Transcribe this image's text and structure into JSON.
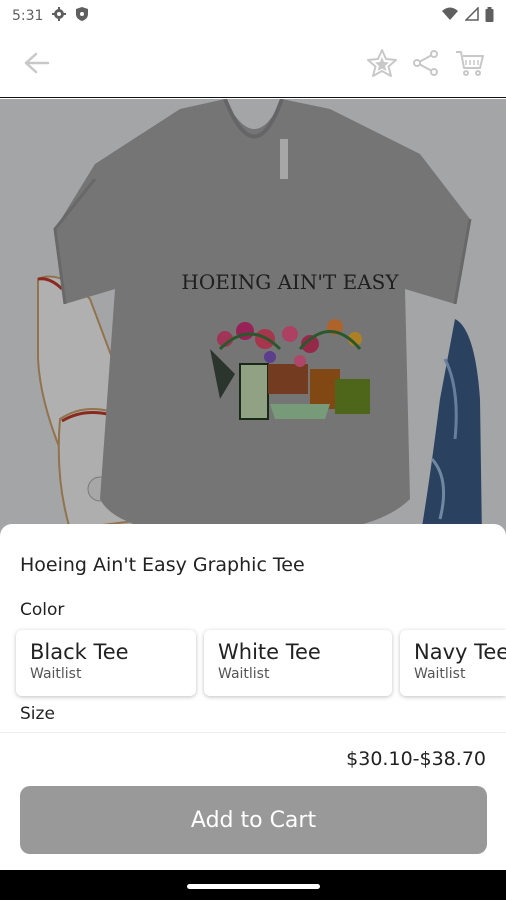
{
  "status_bar": {
    "time": "5:31"
  },
  "product": {
    "title": "Hoeing Ain't Easy Graphic Tee",
    "shirt_text": "HOEING AIN'T EASY"
  },
  "options": {
    "color_label": "Color",
    "colors": [
      {
        "name": "Black Tee",
        "status": "Waitlist"
      },
      {
        "name": "White Tee",
        "status": "Waitlist"
      },
      {
        "name": "Navy Tee",
        "status": "Waitlist"
      }
    ],
    "size_label": "Size"
  },
  "price": "$30.10-$38.70",
  "add_to_cart_label": "Add to Cart",
  "icons": [
    "settings-icon",
    "shield-icon",
    "wifi-icon",
    "signal-icon",
    "battery-icon",
    "back-arrow-icon",
    "star-icon",
    "share-icon",
    "cart-icon"
  ],
  "colors": {
    "button_disabled": "#999999",
    "overlay": "rgba(0,0,0,0.28)"
  }
}
